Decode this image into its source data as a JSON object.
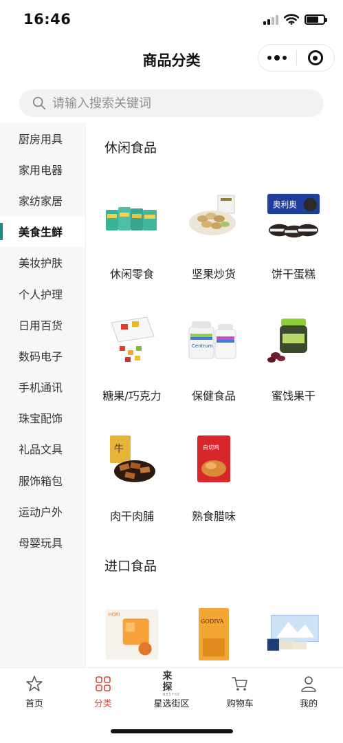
{
  "status_bar": {
    "time": "16:46"
  },
  "nav": {
    "title": "商品分类"
  },
  "search": {
    "placeholder": "请输入搜索关键词"
  },
  "sidebar": {
    "items": [
      {
        "label": "厨房用具",
        "active": false
      },
      {
        "label": "家用电器",
        "active": false
      },
      {
        "label": "家纺家居",
        "active": false
      },
      {
        "label": "美食生鲜",
        "active": true
      },
      {
        "label": "美妆护肤",
        "active": false
      },
      {
        "label": "个人护理",
        "active": false
      },
      {
        "label": "日用百货",
        "active": false
      },
      {
        "label": "数码电子",
        "active": false
      },
      {
        "label": "手机通讯",
        "active": false
      },
      {
        "label": "珠宝配饰",
        "active": false
      },
      {
        "label": "礼品文具",
        "active": false
      },
      {
        "label": "服饰箱包",
        "active": false
      },
      {
        "label": "运动户外",
        "active": false
      },
      {
        "label": "母婴玩具",
        "active": false
      }
    ]
  },
  "sections": [
    {
      "title": "休闲食品",
      "items": [
        {
          "label": "休闲零食",
          "icon": "snack-bags-image"
        },
        {
          "label": "坚果炒货",
          "icon": "pistachio-bowl-image"
        },
        {
          "label": "饼干蛋糕",
          "icon": "oreo-cookies-image"
        },
        {
          "label": "糖果/巧克力",
          "icon": "gummy-candy-image"
        },
        {
          "label": "保健食品",
          "icon": "vitamin-bottles-image"
        },
        {
          "label": "蜜饯果干",
          "icon": "dried-fruit-jar-image"
        },
        {
          "label": "肉干肉脯",
          "icon": "beef-jerky-image"
        },
        {
          "label": "熟食腊味",
          "icon": "roast-chicken-image"
        }
      ]
    },
    {
      "title": "进口食品",
      "items": [
        {
          "label": "",
          "icon": "jelly-cup-image"
        },
        {
          "label": "",
          "icon": "godiva-box-image"
        },
        {
          "label": "",
          "icon": "white-lover-cookies-image"
        }
      ]
    }
  ],
  "product_image_text": {
    "oreo": "奥利奥",
    "centrum": "Centrum",
    "jerky": "牛",
    "chicken": "白切鸡",
    "godiva": "GODIVA",
    "jelly": "HORI"
  },
  "tab_bar": {
    "items": [
      {
        "label": "首页",
        "icon": "star-icon",
        "active": false
      },
      {
        "label": "分类",
        "icon": "category-grid-icon",
        "active": true
      },
      {
        "label": "星选街区",
        "icon": "brand-logo-icon",
        "active": false
      },
      {
        "label": "购物车",
        "icon": "cart-icon",
        "active": false
      },
      {
        "label": "我的",
        "icon": "user-icon",
        "active": false
      }
    ],
    "brand_mark": "来探",
    "brand_sub": "NESTSE"
  },
  "colors": {
    "accent": "#1f8a8a",
    "active_tab": "#e2473e"
  }
}
